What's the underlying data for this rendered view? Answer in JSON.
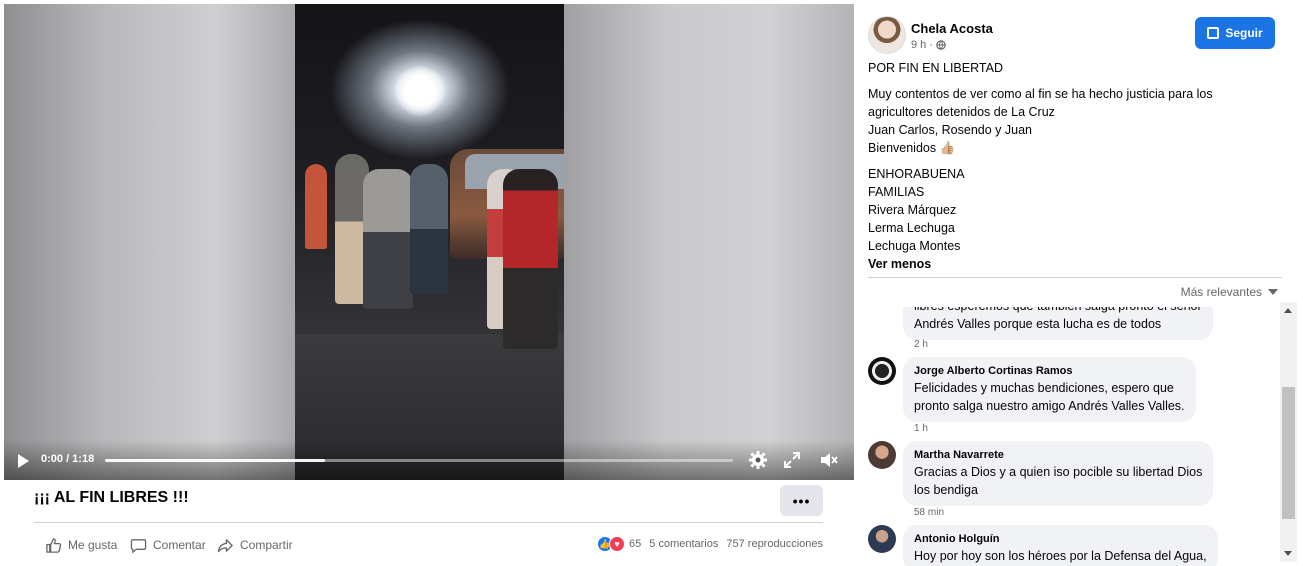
{
  "video": {
    "time_display": "0:00 / 1:18",
    "progress_fraction": 0.0,
    "buffered_fraction": 0.35
  },
  "post": {
    "title": "¡¡¡ AL FIN LIBRES !!!",
    "more_label": "•••",
    "actions": {
      "like": "Me gusta",
      "comment": "Comentar",
      "share": "Compartir"
    },
    "stats": {
      "reactions_count": "65",
      "comments": "5 comentarios",
      "views": "757 reproducciones"
    }
  },
  "author": {
    "name": "Chela Acosta",
    "time": "9 h ·",
    "follow_label": "Seguir"
  },
  "caption": {
    "headline": "POR FIN EN LIBERTAD",
    "lines_1": [
      "Muy contentos de ver como al fin se ha hecho justicia para los",
      "agricultores detenidos de La Cruz",
      "Juan Carlos, Rosendo y Juan",
      "Bienvenidos 👍🏼"
    ],
    "lines_2": [
      "ENHORABUENA",
      "FAMILIAS",
      "Rivera Márquez",
      "Lerma Lechuga",
      "Lechuga Montes"
    ],
    "see_less": "Ver menos"
  },
  "comments_sort": "Más relevantes",
  "comments": [
    {
      "name": "",
      "text_1": "libres esperemos que tambien salga pronto el señor",
      "text_2": "Andrés Valles porque esta lucha es de todos",
      "time": "2 h"
    },
    {
      "name": "Jorge Alberto Cortinas Ramos",
      "text_1": "Felicidades y muchas bendiciones, espero que",
      "text_2": "pronto salga nuestro amigo Andrés Valles Valles.",
      "time": "1 h"
    },
    {
      "name": "Martha Navarrete",
      "text_1": "Gracias a Dios y a quien iso pocible su libertad Dios",
      "text_2": "los bendiga",
      "time": "58 min"
    },
    {
      "name": "Antonio Holguín",
      "text_1": "Hoy por hoy son los héroes por la Defensa del Agua,",
      "text_2": "",
      "time": ""
    }
  ],
  "colors": {
    "accent": "#1b74e4",
    "bubble": "#f0f2f5",
    "secondary_text": "#65676b"
  }
}
